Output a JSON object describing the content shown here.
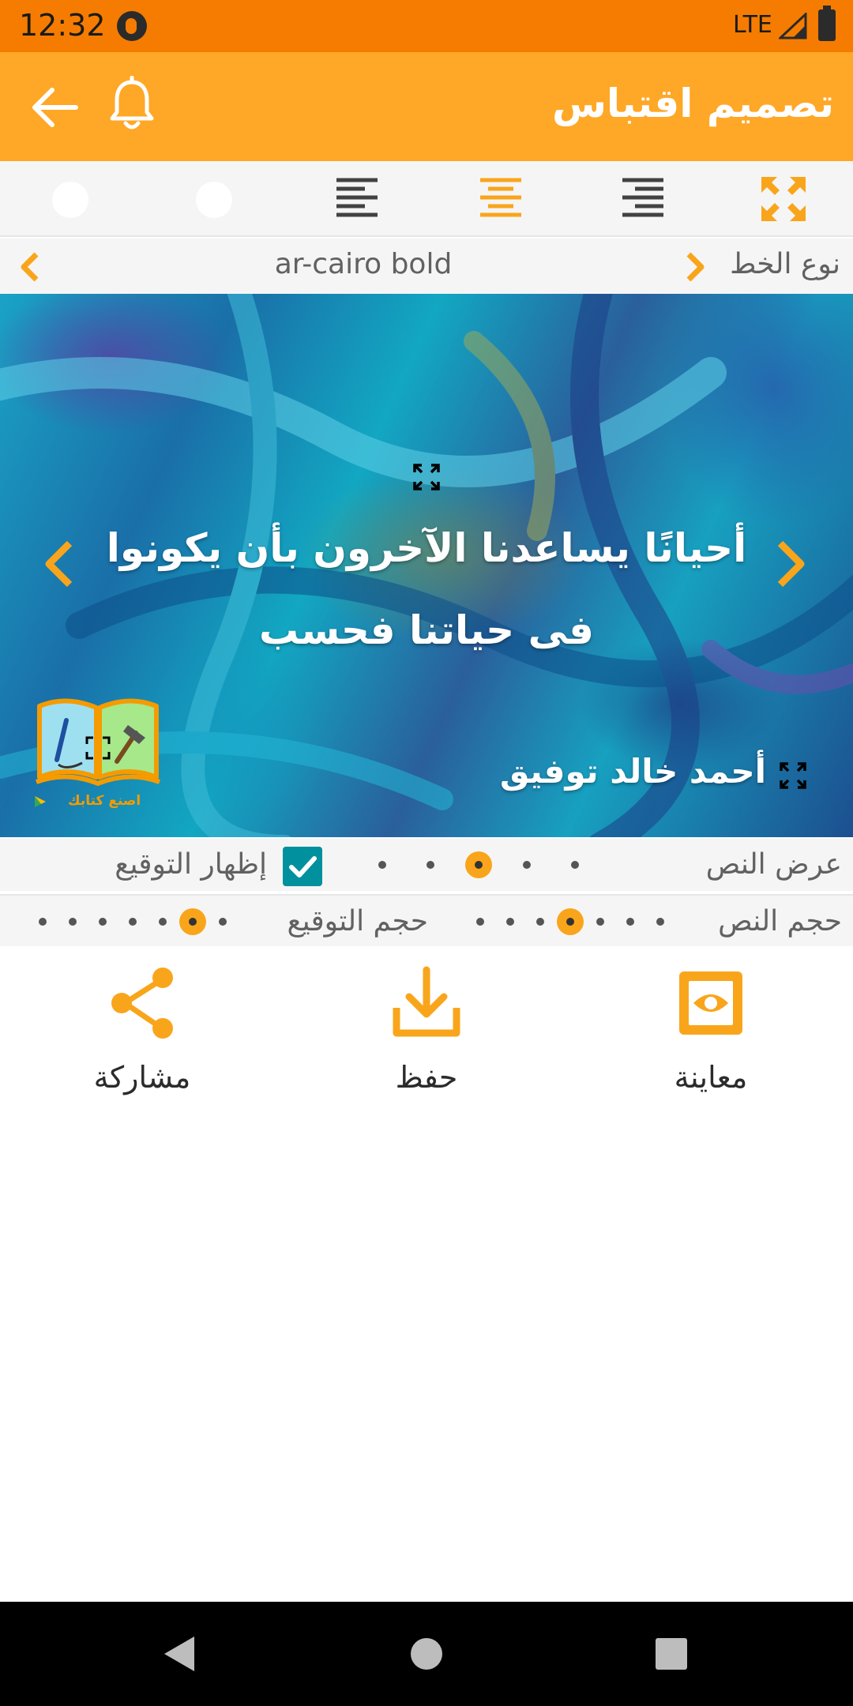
{
  "status_bar": {
    "time": "12:32",
    "network": "LTE"
  },
  "app_bar": {
    "title": "تصميم اقتباس"
  },
  "toolbar": {
    "tools": [
      {
        "name": "fullscreen",
        "icon": "expand-icon",
        "selected": false
      },
      {
        "name": "align-right",
        "icon": "align-right-icon",
        "selected": false
      },
      {
        "name": "align-center",
        "icon": "align-center-icon",
        "selected": true
      },
      {
        "name": "align-left",
        "icon": "align-left-icon",
        "selected": false
      }
    ]
  },
  "font_row": {
    "label": "نوع الخط",
    "value": "ar-cairo bold"
  },
  "canvas": {
    "quote_line1": "أحيانًا يساعدنا الآخرون بأن يكونوا",
    "quote_line2": "فى حياتنا فحسب",
    "author": "أحمد خالد توفيق",
    "logo_caption": "اصنع كتابك"
  },
  "options": {
    "text_width_label": "عرض النص",
    "text_width_dots": 5,
    "text_width_selected": 2,
    "show_signature_label": "إظهار التوقيع",
    "show_signature_checked": true,
    "text_size_label": "حجم النص",
    "text_size_dots": 7,
    "text_size_selected": 3,
    "signature_size_label": "حجم التوقيع",
    "signature_size_dots": 7,
    "signature_size_selected": 1
  },
  "actions": {
    "preview": "معاينة",
    "save": "حفظ",
    "share": "مشاركة"
  },
  "colors": {
    "status_bar": "#f57c00",
    "app_bar": "#ffa726",
    "accent": "#f9a51b",
    "checkbox": "#00909e",
    "nav_bar": "#000000"
  }
}
